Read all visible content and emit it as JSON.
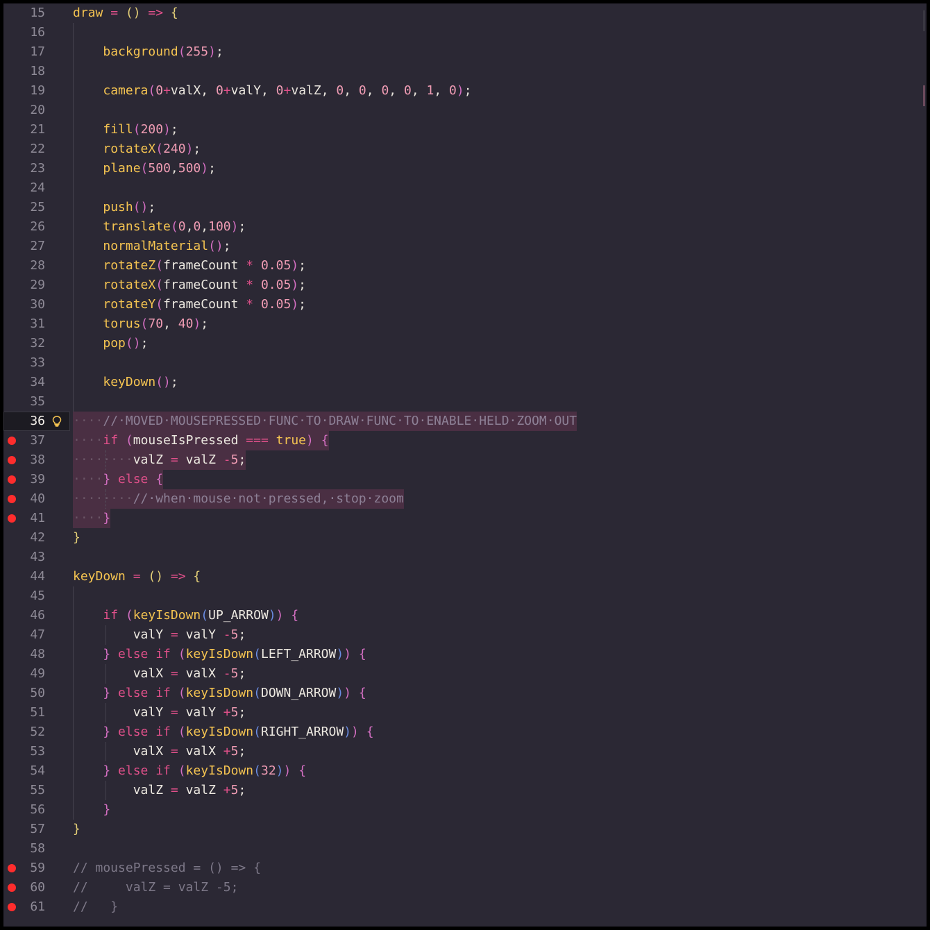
{
  "editor": {
    "current_line": 36,
    "breakpoint_color": "#ff2d2d",
    "icons": {
      "lightbulb": "lightbulb-icon",
      "breakpoint": "breakpoint-icon"
    },
    "lines": [
      {
        "n": "15",
        "tokens": [
          [
            "fn",
            "draw"
          ],
          [
            "op",
            " = "
          ],
          [
            "p1",
            "()"
          ],
          [
            "op",
            " => "
          ],
          [
            "p1",
            "{"
          ]
        ]
      },
      {
        "n": "16",
        "tokens": []
      },
      {
        "n": "17",
        "tokens": [
          [
            "pn",
            "    "
          ],
          [
            "fn",
            "background"
          ],
          [
            "p2",
            "("
          ],
          [
            "num",
            "255"
          ],
          [
            "p2",
            ")"
          ],
          [
            "pn",
            ";"
          ]
        ]
      },
      {
        "n": "18",
        "tokens": []
      },
      {
        "n": "19",
        "tokens": [
          [
            "pn",
            "    "
          ],
          [
            "fn",
            "camera"
          ],
          [
            "p2",
            "("
          ],
          [
            "num",
            "0"
          ],
          [
            "op",
            "+"
          ],
          [
            "id",
            "valX, "
          ],
          [
            "num",
            "0"
          ],
          [
            "op",
            "+"
          ],
          [
            "id",
            "valY, "
          ],
          [
            "num",
            "0"
          ],
          [
            "op",
            "+"
          ],
          [
            "id",
            "valZ, "
          ],
          [
            "num",
            "0"
          ],
          [
            "pn",
            ", "
          ],
          [
            "num",
            "0"
          ],
          [
            "pn",
            ", "
          ],
          [
            "num",
            "0"
          ],
          [
            "pn",
            ", "
          ],
          [
            "num",
            "0"
          ],
          [
            "pn",
            ", "
          ],
          [
            "num",
            "1"
          ],
          [
            "pn",
            ", "
          ],
          [
            "num",
            "0"
          ],
          [
            "p2",
            ")"
          ],
          [
            "pn",
            ";"
          ]
        ]
      },
      {
        "n": "20",
        "tokens": []
      },
      {
        "n": "21",
        "tokens": [
          [
            "pn",
            "    "
          ],
          [
            "fn",
            "fill"
          ],
          [
            "p2",
            "("
          ],
          [
            "num",
            "200"
          ],
          [
            "p2",
            ")"
          ],
          [
            "pn",
            ";"
          ]
        ]
      },
      {
        "n": "22",
        "tokens": [
          [
            "pn",
            "    "
          ],
          [
            "fn",
            "rotateX"
          ],
          [
            "p2",
            "("
          ],
          [
            "num",
            "240"
          ],
          [
            "p2",
            ")"
          ],
          [
            "pn",
            ";"
          ]
        ]
      },
      {
        "n": "23",
        "tokens": [
          [
            "pn",
            "    "
          ],
          [
            "fn",
            "plane"
          ],
          [
            "p2",
            "("
          ],
          [
            "num",
            "500"
          ],
          [
            "pn",
            ","
          ],
          [
            "num",
            "500"
          ],
          [
            "p2",
            ")"
          ],
          [
            "pn",
            ";"
          ]
        ]
      },
      {
        "n": "24",
        "tokens": []
      },
      {
        "n": "25",
        "tokens": [
          [
            "pn",
            "    "
          ],
          [
            "fn",
            "push"
          ],
          [
            "p2",
            "()"
          ],
          [
            "pn",
            ";"
          ]
        ]
      },
      {
        "n": "26",
        "tokens": [
          [
            "pn",
            "    "
          ],
          [
            "fn",
            "translate"
          ],
          [
            "p2",
            "("
          ],
          [
            "num",
            "0"
          ],
          [
            "pn",
            ","
          ],
          [
            "num",
            "0"
          ],
          [
            "pn",
            ","
          ],
          [
            "num",
            "100"
          ],
          [
            "p2",
            ")"
          ],
          [
            "pn",
            ";"
          ]
        ]
      },
      {
        "n": "27",
        "tokens": [
          [
            "pn",
            "    "
          ],
          [
            "fn",
            "normalMaterial"
          ],
          [
            "p2",
            "()"
          ],
          [
            "pn",
            ";"
          ]
        ]
      },
      {
        "n": "28",
        "tokens": [
          [
            "pn",
            "    "
          ],
          [
            "fn",
            "rotateZ"
          ],
          [
            "p2",
            "("
          ],
          [
            "id",
            "frameCount "
          ],
          [
            "op",
            "*"
          ],
          [
            "num",
            " 0.05"
          ],
          [
            "p2",
            ")"
          ],
          [
            "pn",
            ";"
          ]
        ]
      },
      {
        "n": "29",
        "tokens": [
          [
            "pn",
            "    "
          ],
          [
            "fn",
            "rotateX"
          ],
          [
            "p2",
            "("
          ],
          [
            "id",
            "frameCount "
          ],
          [
            "op",
            "*"
          ],
          [
            "num",
            " 0.05"
          ],
          [
            "p2",
            ")"
          ],
          [
            "pn",
            ";"
          ]
        ]
      },
      {
        "n": "30",
        "tokens": [
          [
            "pn",
            "    "
          ],
          [
            "fn",
            "rotateY"
          ],
          [
            "p2",
            "("
          ],
          [
            "id",
            "frameCount "
          ],
          [
            "op",
            "*"
          ],
          [
            "num",
            " 0.05"
          ],
          [
            "p2",
            ")"
          ],
          [
            "pn",
            ";"
          ]
        ]
      },
      {
        "n": "31",
        "tokens": [
          [
            "pn",
            "    "
          ],
          [
            "fn",
            "torus"
          ],
          [
            "p2",
            "("
          ],
          [
            "num",
            "70"
          ],
          [
            "pn",
            ", "
          ],
          [
            "num",
            "40"
          ],
          [
            "p2",
            ")"
          ],
          [
            "pn",
            ";"
          ]
        ]
      },
      {
        "n": "32",
        "tokens": [
          [
            "pn",
            "    "
          ],
          [
            "fn",
            "pop"
          ],
          [
            "p2",
            "()"
          ],
          [
            "pn",
            ";"
          ]
        ]
      },
      {
        "n": "33",
        "tokens": []
      },
      {
        "n": "34",
        "tokens": [
          [
            "pn",
            "    "
          ],
          [
            "fn",
            "keyDown"
          ],
          [
            "p2",
            "()"
          ],
          [
            "pn",
            ";"
          ]
        ]
      },
      {
        "n": "35",
        "tokens": []
      },
      {
        "n": "36",
        "current": true,
        "bulb": true,
        "hl": true,
        "tokens": [
          [
            "ws",
            "····"
          ],
          [
            "cmh",
            "//·MOVED·MOUSEPRESSED·FUNC·TO·DRAW·FUNC·TO·ENABLE·HELD·ZOOM·OUT"
          ]
        ]
      },
      {
        "n": "37",
        "bp": true,
        "hl": true,
        "tokens": [
          [
            "ws",
            "····"
          ],
          [
            "kw",
            "if"
          ],
          [
            "pn",
            " "
          ],
          [
            "p2",
            "("
          ],
          [
            "id",
            "mouseIsPressed "
          ],
          [
            "op",
            "==="
          ],
          [
            "bool",
            " true"
          ],
          [
            "p2",
            ")"
          ],
          [
            "pn",
            " "
          ],
          [
            "p2",
            "{"
          ]
        ]
      },
      {
        "n": "38",
        "bp": true,
        "hl": true,
        "tokens": [
          [
            "ws",
            "········"
          ],
          [
            "id",
            "valZ "
          ],
          [
            "op",
            "="
          ],
          [
            "id",
            " valZ "
          ],
          [
            "op",
            "-"
          ],
          [
            "num",
            "5"
          ],
          [
            "pn",
            ";"
          ]
        ]
      },
      {
        "n": "39",
        "bp": true,
        "hl": true,
        "tokens": [
          [
            "ws",
            "····"
          ],
          [
            "p2",
            "}"
          ],
          [
            "kw",
            " else "
          ],
          [
            "p2",
            "{"
          ]
        ]
      },
      {
        "n": "40",
        "bp": true,
        "hl": true,
        "tokens": [
          [
            "ws",
            "········"
          ],
          [
            "cmh",
            "//·when·mouse·not·pressed,·stop·zoom"
          ]
        ]
      },
      {
        "n": "41",
        "bp": true,
        "hl": true,
        "tokens": [
          [
            "ws",
            "····"
          ],
          [
            "p2",
            "}"
          ]
        ]
      },
      {
        "n": "42",
        "tokens": [
          [
            "p1",
            "}"
          ]
        ]
      },
      {
        "n": "43",
        "tokens": []
      },
      {
        "n": "44",
        "tokens": [
          [
            "fn",
            "keyDown"
          ],
          [
            "op",
            " = "
          ],
          [
            "p1",
            "()"
          ],
          [
            "op",
            " => "
          ],
          [
            "p1",
            "{"
          ]
        ]
      },
      {
        "n": "45",
        "tokens": []
      },
      {
        "n": "46",
        "tokens": [
          [
            "pn",
            "    "
          ],
          [
            "kw",
            "if"
          ],
          [
            "pn",
            " "
          ],
          [
            "p2",
            "("
          ],
          [
            "fn",
            "keyIsDown"
          ],
          [
            "p3",
            "("
          ],
          [
            "id",
            "UP_ARROW"
          ],
          [
            "p3",
            ")"
          ],
          [
            "p2",
            ")"
          ],
          [
            "pn",
            " "
          ],
          [
            "p2",
            "{"
          ]
        ]
      },
      {
        "n": "47",
        "tokens": [
          [
            "pn",
            "        "
          ],
          [
            "id",
            "valY "
          ],
          [
            "op",
            "="
          ],
          [
            "id",
            " valY "
          ],
          [
            "op",
            "-"
          ],
          [
            "num",
            "5"
          ],
          [
            "pn",
            ";"
          ]
        ]
      },
      {
        "n": "48",
        "tokens": [
          [
            "pn",
            "    "
          ],
          [
            "p2",
            "}"
          ],
          [
            "kw",
            " else if "
          ],
          [
            "p2",
            "("
          ],
          [
            "fn",
            "keyIsDown"
          ],
          [
            "p3",
            "("
          ],
          [
            "id",
            "LEFT_ARROW"
          ],
          [
            "p3",
            ")"
          ],
          [
            "p2",
            ")"
          ],
          [
            "pn",
            " "
          ],
          [
            "p2",
            "{"
          ]
        ]
      },
      {
        "n": "49",
        "tokens": [
          [
            "pn",
            "        "
          ],
          [
            "id",
            "valX "
          ],
          [
            "op",
            "="
          ],
          [
            "id",
            " valX "
          ],
          [
            "op",
            "-"
          ],
          [
            "num",
            "5"
          ],
          [
            "pn",
            ";"
          ]
        ]
      },
      {
        "n": "50",
        "tokens": [
          [
            "pn",
            "    "
          ],
          [
            "p2",
            "}"
          ],
          [
            "kw",
            " else if "
          ],
          [
            "p2",
            "("
          ],
          [
            "fn",
            "keyIsDown"
          ],
          [
            "p3",
            "("
          ],
          [
            "id",
            "DOWN_ARROW"
          ],
          [
            "p3",
            ")"
          ],
          [
            "p2",
            ")"
          ],
          [
            "pn",
            " "
          ],
          [
            "p2",
            "{"
          ]
        ]
      },
      {
        "n": "51",
        "tokens": [
          [
            "pn",
            "        "
          ],
          [
            "id",
            "valY "
          ],
          [
            "op",
            "="
          ],
          [
            "id",
            " valY "
          ],
          [
            "op",
            "+"
          ],
          [
            "num",
            "5"
          ],
          [
            "pn",
            ";"
          ]
        ]
      },
      {
        "n": "52",
        "tokens": [
          [
            "pn",
            "    "
          ],
          [
            "p2",
            "}"
          ],
          [
            "kw",
            " else if "
          ],
          [
            "p2",
            "("
          ],
          [
            "fn",
            "keyIsDown"
          ],
          [
            "p3",
            "("
          ],
          [
            "id",
            "RIGHT_ARROW"
          ],
          [
            "p3",
            ")"
          ],
          [
            "p2",
            ")"
          ],
          [
            "pn",
            " "
          ],
          [
            "p2",
            "{"
          ]
        ]
      },
      {
        "n": "53",
        "tokens": [
          [
            "pn",
            "        "
          ],
          [
            "id",
            "valX "
          ],
          [
            "op",
            "="
          ],
          [
            "id",
            " valX "
          ],
          [
            "op",
            "+"
          ],
          [
            "num",
            "5"
          ],
          [
            "pn",
            ";"
          ]
        ]
      },
      {
        "n": "54",
        "tokens": [
          [
            "pn",
            "    "
          ],
          [
            "p2",
            "}"
          ],
          [
            "kw",
            " else if "
          ],
          [
            "p2",
            "("
          ],
          [
            "fn",
            "keyIsDown"
          ],
          [
            "p3",
            "("
          ],
          [
            "num",
            "32"
          ],
          [
            "p3",
            ")"
          ],
          [
            "p2",
            ")"
          ],
          [
            "pn",
            " "
          ],
          [
            "p2",
            "{"
          ]
        ]
      },
      {
        "n": "55",
        "tokens": [
          [
            "pn",
            "        "
          ],
          [
            "id",
            "valZ "
          ],
          [
            "op",
            "="
          ],
          [
            "id",
            " valZ "
          ],
          [
            "op",
            "+"
          ],
          [
            "num",
            "5"
          ],
          [
            "pn",
            ";"
          ]
        ]
      },
      {
        "n": "56",
        "tokens": [
          [
            "pn",
            "    "
          ],
          [
            "p2",
            "}"
          ]
        ]
      },
      {
        "n": "57",
        "tokens": [
          [
            "p1",
            "}"
          ]
        ]
      },
      {
        "n": "58",
        "tokens": []
      },
      {
        "n": "59",
        "bp": true,
        "tokens": [
          [
            "cm",
            "// mousePressed = () => {"
          ]
        ]
      },
      {
        "n": "60",
        "bp": true,
        "tokens": [
          [
            "cm",
            "//     valZ = valZ -5;"
          ]
        ]
      },
      {
        "n": "61",
        "bp": true,
        "tokens": [
          [
            "cm",
            "//   }"
          ]
        ]
      }
    ]
  }
}
